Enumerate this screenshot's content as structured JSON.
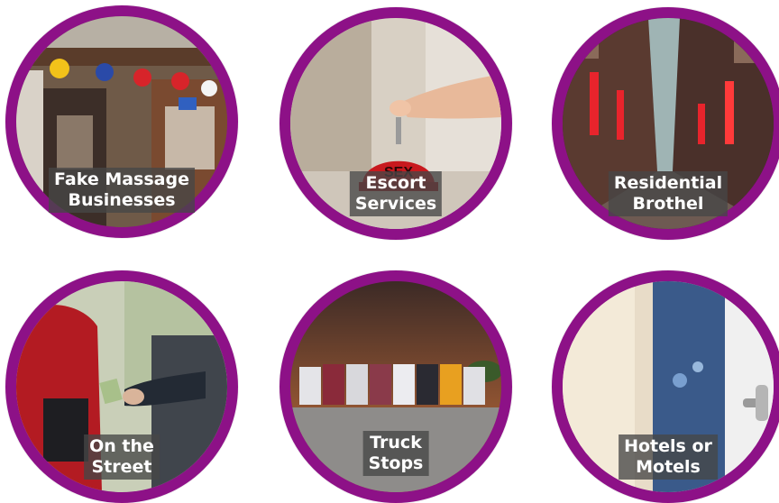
{
  "tiles": [
    {
      "line1": "Fake Massage",
      "line2": "Businesses",
      "icon": "storefront-photo"
    },
    {
      "line1": "Escort",
      "line2": "Services",
      "icon": "bell-photo"
    },
    {
      "line1": "Residential",
      "line2": "Brothel",
      "icon": "alley-photo"
    },
    {
      "line1": "On the",
      "line2": "Street",
      "icon": "street-photo"
    },
    {
      "line1": "Truck",
      "line2": "Stops",
      "icon": "trucks-photo"
    },
    {
      "line1": "Hotels or",
      "line2": "Motels",
      "icon": "hotel-door-photo"
    }
  ],
  "colors": {
    "ring": "#8d1187",
    "label_bg": "#464646",
    "label_text": "#ffffff"
  }
}
